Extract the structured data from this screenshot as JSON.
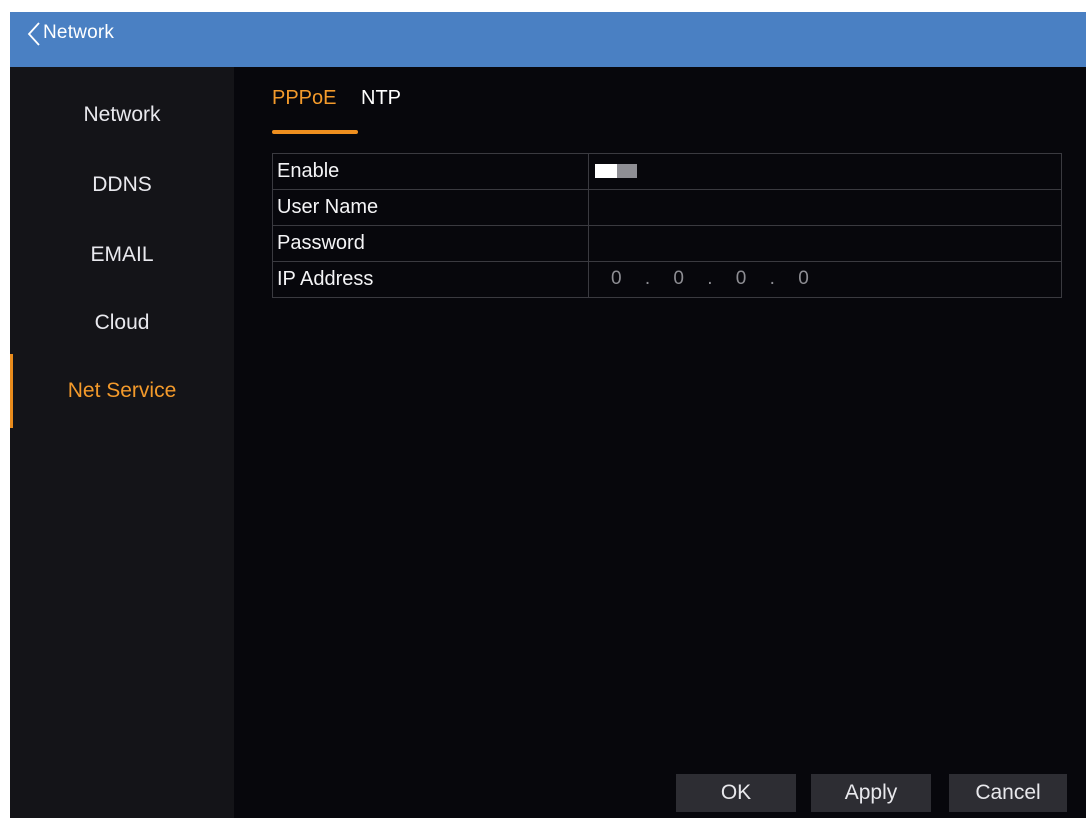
{
  "header": {
    "title": "Network",
    "back_icon": "chevron-left-icon"
  },
  "sidebar": {
    "items": [
      {
        "label": "Network",
        "active": false
      },
      {
        "label": "DDNS",
        "active": false
      },
      {
        "label": "EMAIL",
        "active": false
      },
      {
        "label": "Cloud",
        "active": false
      },
      {
        "label": "Net Service",
        "active": true
      }
    ]
  },
  "tabs": [
    {
      "label": "PPPoE",
      "active": true
    },
    {
      "label": "NTP",
      "active": false
    }
  ],
  "form": {
    "rows": [
      {
        "label": "Enable",
        "type": "toggle",
        "value": "off"
      },
      {
        "label": "User Name",
        "type": "text",
        "value": ""
      },
      {
        "label": "Password",
        "type": "password",
        "value": ""
      },
      {
        "label": "IP Address",
        "type": "ip",
        "value": "0 . 0 . 0 . 0"
      }
    ]
  },
  "buttons": {
    "ok": "OK",
    "apply": "Apply",
    "cancel": "Cancel"
  },
  "colors": {
    "titlebar": "#4a80c3",
    "accent": "#f39a2b",
    "background": "#07070c",
    "sidebar": "#141418"
  }
}
